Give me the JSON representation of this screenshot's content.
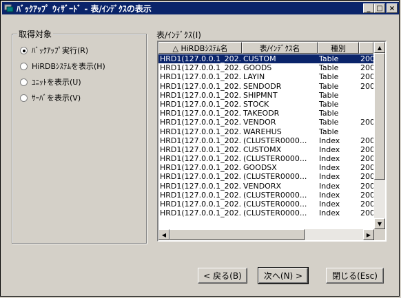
{
  "window": {
    "title": "ﾊﾞｯｸｱｯﾌﾟ ｳｨｻﾞｰﾄﾞ - 表/ｲﾝﾃﾞｸｽの表示"
  },
  "group": {
    "title": "取得対象",
    "options": [
      {
        "label": "ﾊﾞｯｸｱｯﾌﾟ実行(R)",
        "checked": true
      },
      {
        "label": "HiRDBｼｽﾃﾑを表示(H)",
        "checked": false
      },
      {
        "label": "ﾕﾆｯﾄを表示(U)",
        "checked": false
      },
      {
        "label": "ｻｰﾊﾞを表示(V)",
        "checked": false
      }
    ]
  },
  "list": {
    "label": "表/ｲﾝﾃﾞｸｽ(I)",
    "columns": [
      "△  HiRDBｼｽﾃﾑ名",
      "表/ｲﾝﾃﾞｸｽ名",
      "種別",
      ""
    ],
    "rows": [
      [
        "HRD1(127.0.0.1_202...",
        "CUSTOM",
        "Table",
        "200"
      ],
      [
        "HRD1(127.0.0.1_202...",
        "GOODS",
        "Table",
        "200"
      ],
      [
        "HRD1(127.0.0.1_202...",
        "LAYIN",
        "Table",
        "200"
      ],
      [
        "HRD1(127.0.0.1_202...",
        "SENDODR",
        "Table",
        "200"
      ],
      [
        "HRD1(127.0.0.1_202...",
        "SHIPMNT",
        "Table",
        ""
      ],
      [
        "HRD1(127.0.0.1_202...",
        "STOCK",
        "Table",
        ""
      ],
      [
        "HRD1(127.0.0.1_202...",
        "TAKEODR",
        "Table",
        ""
      ],
      [
        "HRD1(127.0.0.1_202...",
        "VENDOR",
        "Table",
        "200"
      ],
      [
        "HRD1(127.0.0.1_202...",
        "WAREHUS",
        "Table",
        ""
      ],
      [
        "HRD1(127.0.0.1_202...",
        "(CLUSTER0000...",
        "Index",
        "200"
      ],
      [
        "HRD1(127.0.0.1_202...",
        "CUSTOMX",
        "Index",
        "200"
      ],
      [
        "HRD1(127.0.0.1_202...",
        "(CLUSTER0000...",
        "Index",
        "200"
      ],
      [
        "HRD1(127.0.0.1_202...",
        "GOODSX",
        "Index",
        "200"
      ],
      [
        "HRD1(127.0.0.1_202...",
        "(CLUSTER0000...",
        "Index",
        "200"
      ],
      [
        "HRD1(127.0.0.1_202...",
        "VENDORX",
        "Index",
        "200"
      ],
      [
        "HRD1(127.0.0.1_202...",
        "(CLUSTER0000...",
        "Index",
        "200"
      ],
      [
        "HRD1(127.0.0.1_202...",
        "(CLUSTER0000...",
        "Index",
        "200"
      ],
      [
        "HRD1(127.0.0.1_202...",
        "(CLUSTER0000...",
        "Index",
        "200"
      ]
    ],
    "selected_row": 0
  },
  "buttons": {
    "back": "< 戻る(B)",
    "next": "次へ(N) >",
    "close": "閉じる(Esc)"
  },
  "colors": {
    "title_bar": "#0a246a",
    "face": "#d4d0c8",
    "selection": "#0a246a"
  }
}
